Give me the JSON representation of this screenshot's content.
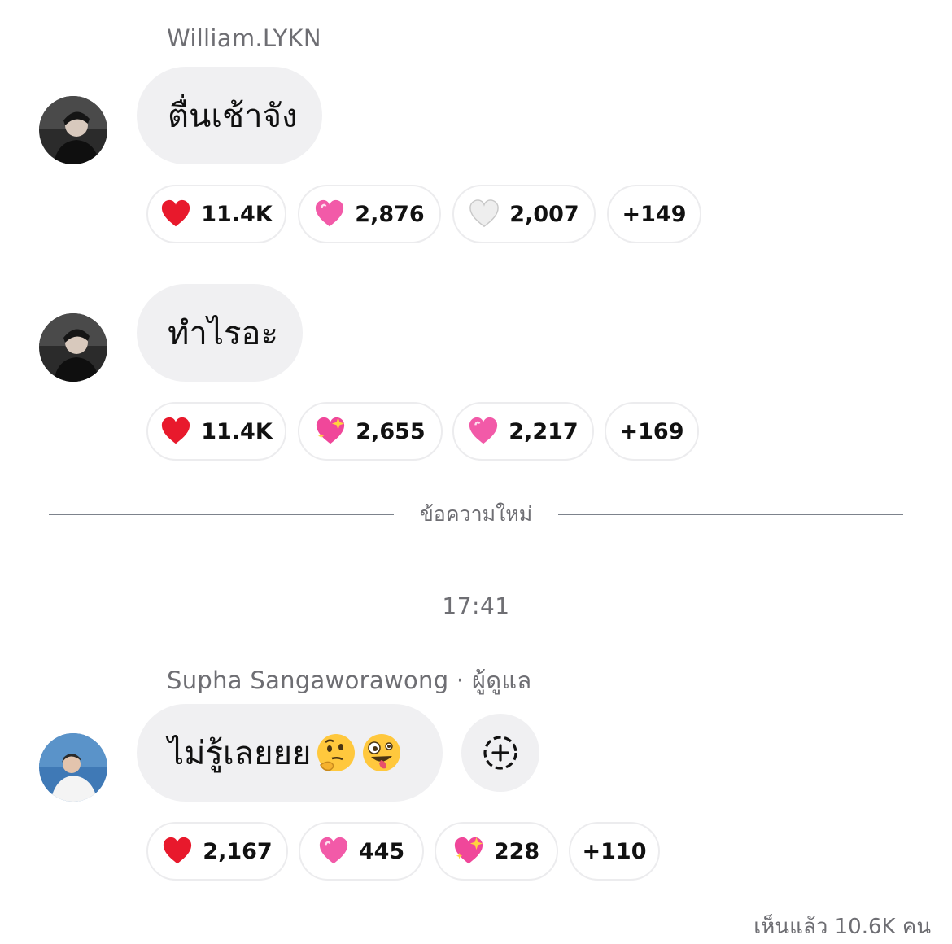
{
  "messages": [
    {
      "sender": "William.LYKN",
      "text": "ตื่นเช้าจัง",
      "reactions": [
        {
          "icon": "red-heart-icon",
          "count": "11.4K"
        },
        {
          "icon": "pink-heart-icon",
          "count": "2,876"
        },
        {
          "icon": "white-heart-icon",
          "count": "2,007"
        },
        {
          "count": "+149"
        }
      ]
    },
    {
      "text": "ทำไรอะ",
      "reactions": [
        {
          "icon": "red-heart-icon",
          "count": "11.4K"
        },
        {
          "icon": "sparkling-heart-icon",
          "count": "2,655"
        },
        {
          "icon": "pink-heart-icon",
          "count": "2,217"
        },
        {
          "count": "+169"
        }
      ]
    },
    {
      "sender": "Supha Sangaworawong · ผู้ดูแล",
      "text": "ไม่รู้เลยยย",
      "emojis": [
        "thinking-face-icon",
        "zany-face-icon"
      ],
      "reactions": [
        {
          "icon": "red-heart-icon",
          "count": "2,167"
        },
        {
          "icon": "pink-heart-icon",
          "count": "445"
        },
        {
          "icon": "sparkling-heart-icon",
          "count": "228"
        },
        {
          "count": "+110"
        }
      ]
    }
  ],
  "divider": {
    "label": "ข้อความใหม่"
  },
  "timestamp": "17:41",
  "seen": "เห็นแล้ว 10.6K คน",
  "colors": {
    "bubble": "#f0f0f2",
    "muted_text": "#6e6e73",
    "divider": "#7d838c",
    "heart_red": "#e8192c",
    "heart_pink": "#f25aa8"
  }
}
